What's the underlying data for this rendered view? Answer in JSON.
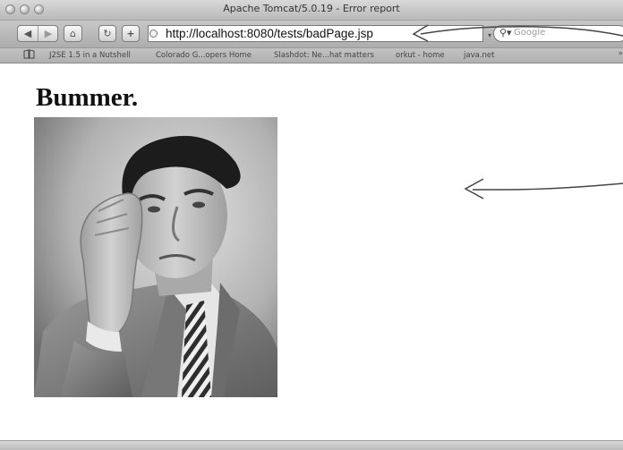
{
  "window": {
    "title": "Apache Tomcat/5.0.19 - Error report"
  },
  "toolbar": {
    "back_glyph": "◀",
    "forward_glyph": "▶",
    "home_glyph": "⌂",
    "reload_glyph": "↻",
    "add_glyph": "+",
    "url": "http://localhost:8080/tests/badPage.jsp",
    "search_placeholder": "Google",
    "search_glyph": "⚲▾",
    "search_dropdown_glyph": "▾"
  },
  "bookmarks": {
    "icon_glyph": "📖",
    "items": [
      "J2SE 1.5 in a Nutshell",
      "Colorado G...opers Home",
      "Slashdot: Ne...hat matters",
      "orkut - home",
      "java.net"
    ],
    "more_glyph": "»"
  },
  "page": {
    "heading": "Bummer.",
    "photo": "frustrated man holding his head in black-and-white photo"
  },
  "icons": {
    "back": "back-arrow-icon",
    "forward": "forward-arrow-icon",
    "home": "home-icon",
    "reload": "reload-icon",
    "add": "add-bookmark-icon",
    "favicon": "globe-icon",
    "search": "magnifier-icon",
    "bookmarks": "book-icon"
  },
  "colors": {
    "chrome": "#b9b9b9",
    "page_bg": "#ffffff",
    "annotation": "#444444"
  }
}
